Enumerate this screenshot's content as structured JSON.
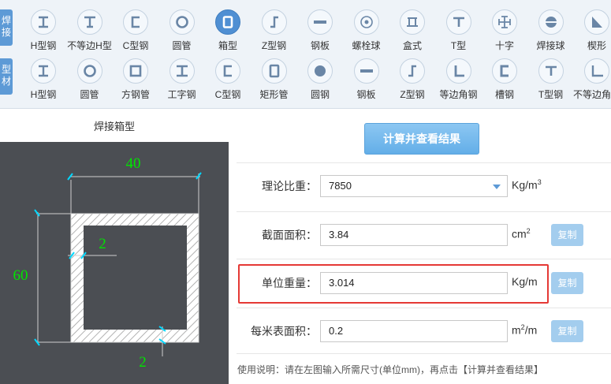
{
  "toolbar": {
    "tab_welded": [
      "焊",
      "接"
    ],
    "tab_profile": [
      "型",
      "材"
    ],
    "row1": [
      {
        "label": "H型钢",
        "icon": "h-beam-icon"
      },
      {
        "label": "不等边H型",
        "icon": "unequal-h-beam-icon"
      },
      {
        "label": "C型钢",
        "icon": "c-channel-icon"
      },
      {
        "label": "圆管",
        "icon": "round-tube-icon"
      },
      {
        "label": "箱型",
        "icon": "box-section-icon",
        "active": true
      },
      {
        "label": "Z型钢",
        "icon": "z-section-icon"
      },
      {
        "label": "钢板",
        "icon": "steel-plate-icon"
      },
      {
        "label": "螺栓球",
        "icon": "bolt-ball-icon"
      },
      {
        "label": "盒式",
        "icon": "box-type-icon"
      },
      {
        "label": "T型",
        "icon": "t-section-icon"
      },
      {
        "label": "十字",
        "icon": "cross-section-icon"
      },
      {
        "label": "焊接球",
        "icon": "welded-ball-icon"
      },
      {
        "label": "楔形",
        "icon": "wedge-icon"
      }
    ],
    "row2": [
      {
        "label": "H型钢",
        "icon": "h-beam-icon"
      },
      {
        "label": "圆管",
        "icon": "round-tube-icon"
      },
      {
        "label": "方钢管",
        "icon": "square-tube-icon"
      },
      {
        "label": "工字钢",
        "icon": "i-beam-icon"
      },
      {
        "label": "C型钢",
        "icon": "c-channel-icon"
      },
      {
        "label": "矩形管",
        "icon": "rect-tube-icon"
      },
      {
        "label": "圆钢",
        "icon": "round-bar-icon"
      },
      {
        "label": "钢板",
        "icon": "steel-plate-icon"
      },
      {
        "label": "Z型钢",
        "icon": "z-section-icon"
      },
      {
        "label": "等边角钢",
        "icon": "equal-angle-icon"
      },
      {
        "label": "槽钢",
        "icon": "channel-icon"
      },
      {
        "label": "T型钢",
        "icon": "t-section-icon"
      },
      {
        "label": "不等边角钢",
        "icon": "unequal-angle-icon"
      }
    ]
  },
  "diagram": {
    "title": "焊接箱型",
    "width_value": "40",
    "height_value": "60",
    "web_thickness": "2",
    "flange_thickness": "2"
  },
  "form": {
    "calc_button": "计算并查看结果",
    "density_label": "理论比重：",
    "density_value": "7850",
    "density_unit": "Kg/m",
    "density_unit_exp": "3",
    "area_label": "截面面积：",
    "area_value": "3.84",
    "area_unit": "cm",
    "area_unit_exp": "2",
    "weight_label": "单位重量：",
    "weight_value": "3.014",
    "weight_unit": "Kg/m",
    "surface_label": "每米表面积：",
    "surface_value": "0.2",
    "surface_unit_pre": "m",
    "surface_unit_exp": "2",
    "surface_unit_post": "/m",
    "copy_label": "复制",
    "usage": "使用说明：请在左图输入所需尺寸(单位mm)，再点击【计算并查看结果】"
  },
  "colors": {
    "accent": "#5d9ad6",
    "diagram_bg": "#4b4e53",
    "dimension_green": "#00e600",
    "dimension_cyan": "#00d8ff",
    "highlight_red": "#e53935"
  }
}
